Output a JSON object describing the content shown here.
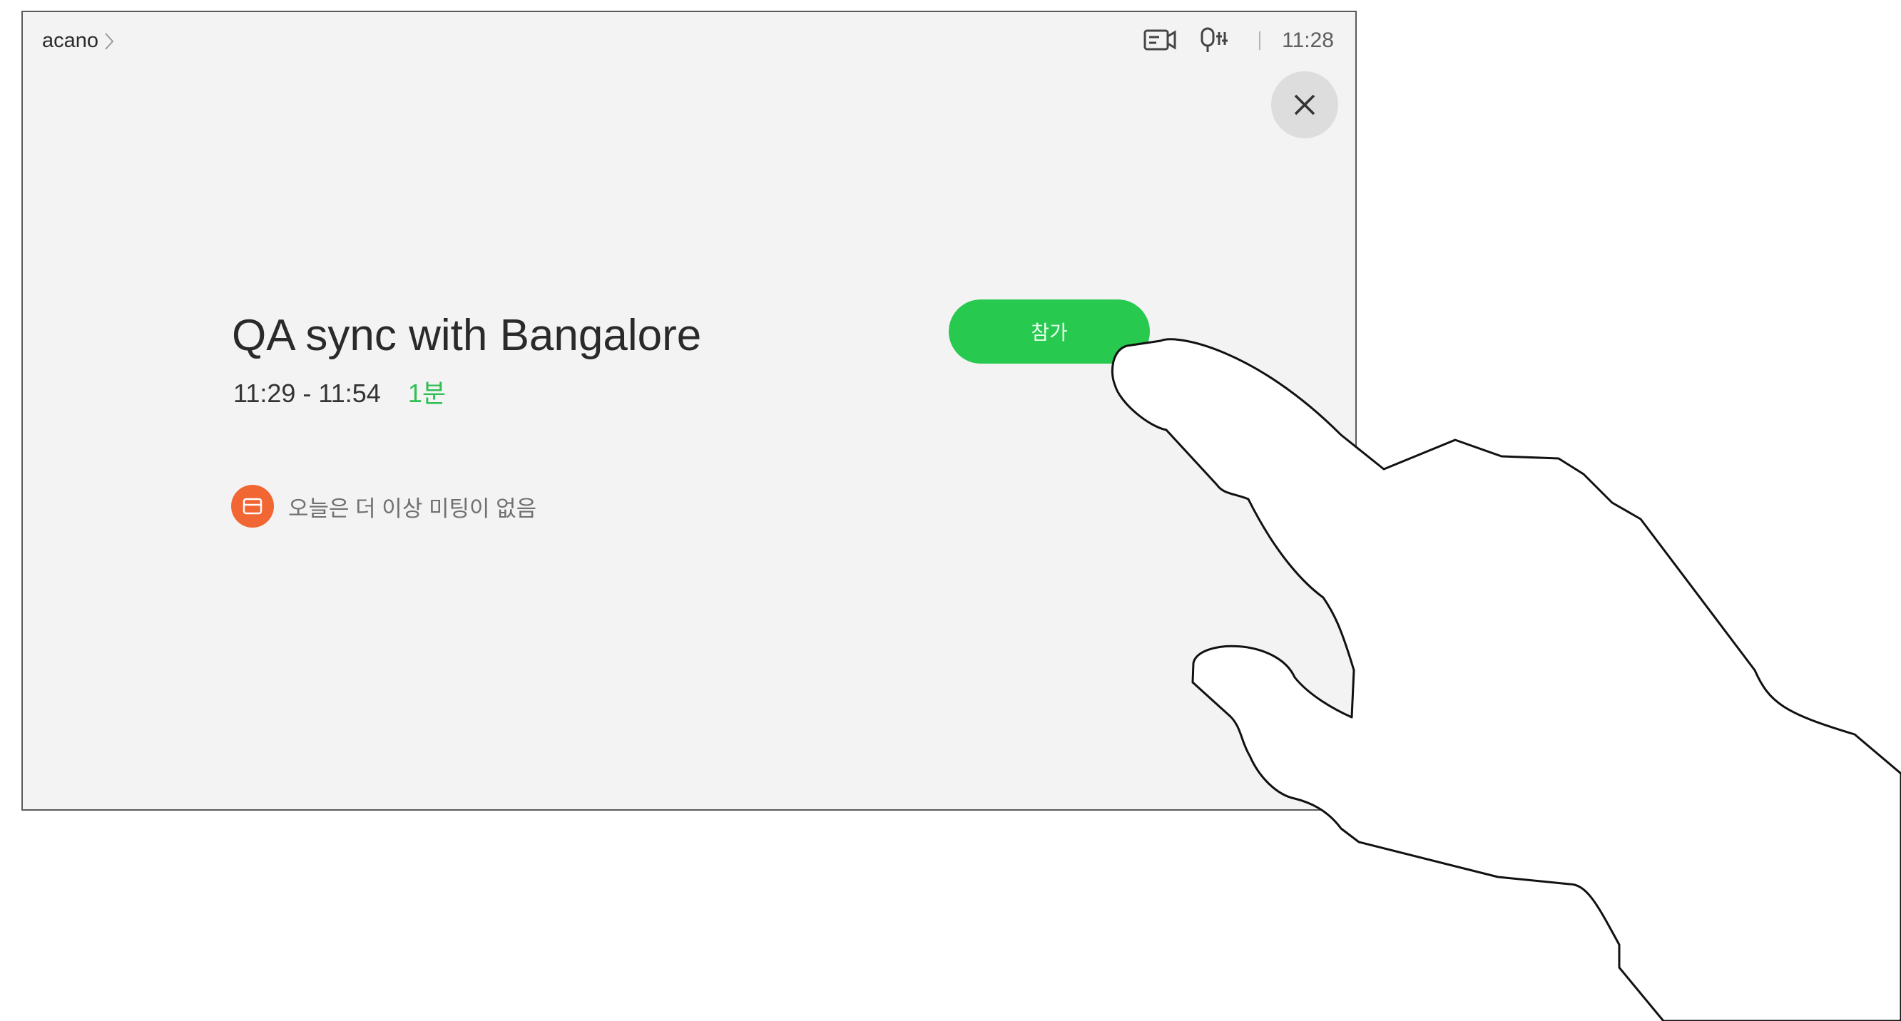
{
  "header": {
    "device_name": "acano",
    "time": "11:28",
    "icons": [
      "chevron-right-icon",
      "self-view-camera-icon",
      "microphone-icon",
      "close-icon"
    ]
  },
  "meeting": {
    "title": "QA sync with Bangalore",
    "time_range": "11:29 - 11:54",
    "starts_in": "1분",
    "join_label": "참가"
  },
  "notice": {
    "text": "오늘은 더 이상 미팅이 없음",
    "icon": "calendar-icon"
  },
  "colors": {
    "join_green": "#27c94f",
    "minutes_green": "#2fbf55",
    "badge_orange": "#f26634",
    "screen_bg": "#f3f3f3"
  }
}
